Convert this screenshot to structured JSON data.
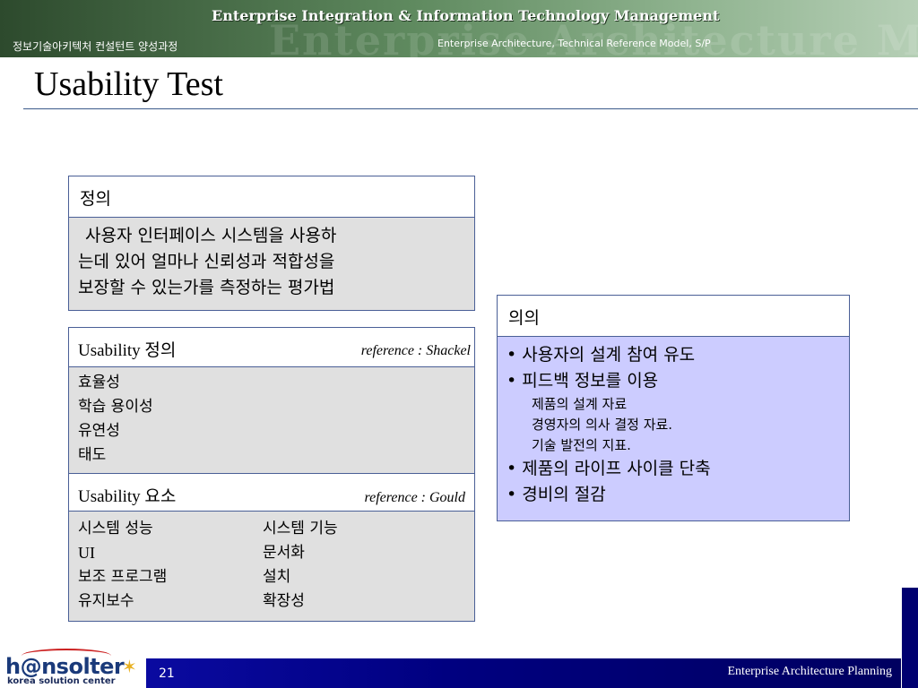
{
  "header": {
    "banner_title": "Enterprise Integration & Information Technology Management",
    "banner_deco": "Enterprise Architecture Model",
    "course": "정보기술아키텍처 컨설턴트 양성과정",
    "subtitle": "Enterprise Architecture, Technical Reference Model, S/P"
  },
  "title": "Usability Test",
  "definition": {
    "label": "정의",
    "lines": [
      "사용자 인터페이스 시스템을 사용하",
      "는데 있어 얼마나 신뢰성과 적합성을",
      "보장할 수 있는가를 측정하는 평가법"
    ]
  },
  "usability_definition": {
    "label": "Usability 정의",
    "reference": "reference : Shackel",
    "items": [
      "효율성",
      "학습 용이성",
      "유연성",
      "태도"
    ]
  },
  "usability_elements": {
    "label": "Usability 요소",
    "reference": "reference : Gould",
    "col1": [
      "시스템 성능",
      "UI",
      "보조 프로그램",
      "유지보수"
    ],
    "col2": [
      "시스템 기능",
      "문서화",
      "설치",
      "확장성"
    ]
  },
  "meaning": {
    "label": "의의",
    "items": [
      "• 사용자의 설계 참여 유도",
      "• 피드백 정보를 이용",
      "제품의 설계 자료",
      "경영자의 의사 결정 자료.",
      "기술 발전의 지표.",
      "• 제품의 라이프 사이클 단축",
      "• 경비의 절감"
    ]
  },
  "footer": {
    "page_number": "21",
    "text": "Enterprise Architecture Planning",
    "logo_main": "h@nsolter",
    "logo_sub": "korea solution center"
  }
}
